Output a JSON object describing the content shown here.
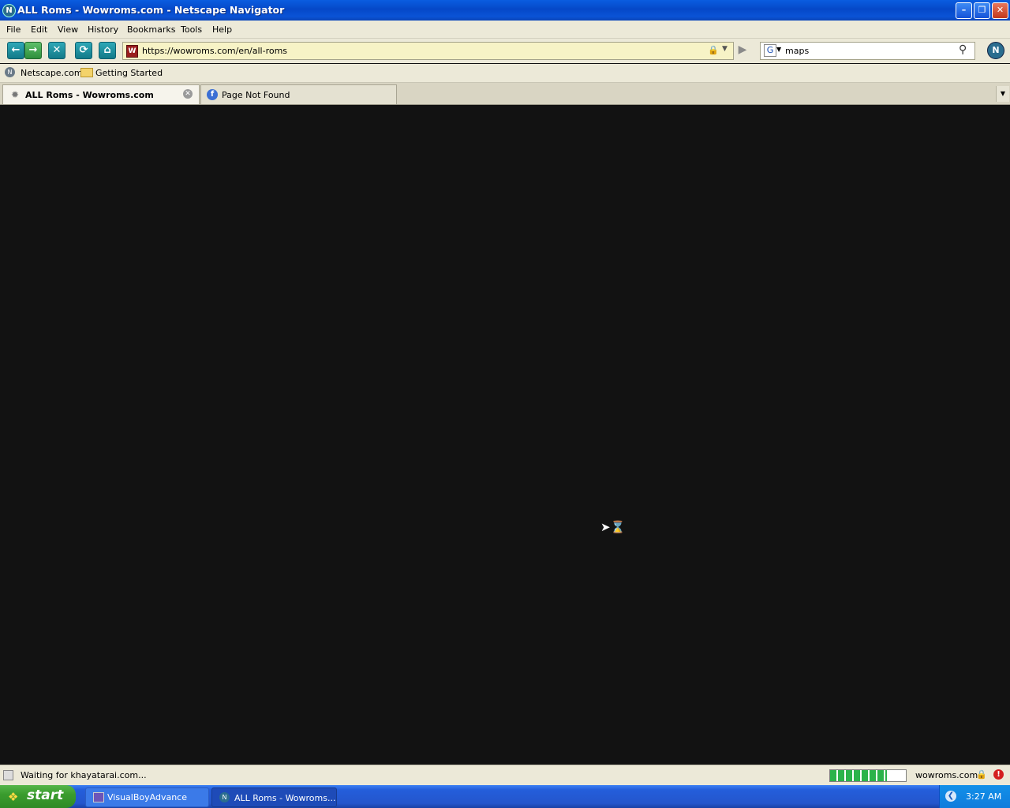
{
  "window": {
    "title": "ALL Roms - Wowroms.com - Netscape Navigator",
    "app_icon_letter": "N"
  },
  "menu": [
    "File",
    "Edit",
    "View",
    "History",
    "Bookmarks",
    "Tools",
    "Help"
  ],
  "toolbar": {
    "url": "https://wowroms.com/en/all-roms",
    "search_engine_icon": "G",
    "search_value": "maps"
  },
  "bookmarks": [
    "Netscape.com",
    "Getting Started"
  ],
  "tabs": [
    {
      "label": "ALL Roms - Wowroms.com",
      "active": true
    },
    {
      "label": "Page Not Found",
      "active": false
    }
  ],
  "status": {
    "text": "Waiting for khayatarai.com...",
    "progress_percent": 75,
    "domain": "wowroms.com"
  },
  "taskbar": {
    "start_label": "start",
    "tasks": [
      "VisualBoyAdvance",
      "ALL Roms - Wowroms..."
    ],
    "clock": "3:27 AM"
  },
  "colors": {
    "page_background": "#121212",
    "titlebar": "#0a53d6",
    "chrome": "#ece9d8",
    "url_field": "#f7f3c6",
    "progress_fill": "#2bb34a"
  },
  "icons": [
    "netscape-logo-icon",
    "back-icon",
    "forward-icon",
    "stop-icon",
    "reload-icon",
    "home-icon",
    "lock-icon",
    "go-icon",
    "search-icon",
    "hourglass-cursor-icon"
  ]
}
